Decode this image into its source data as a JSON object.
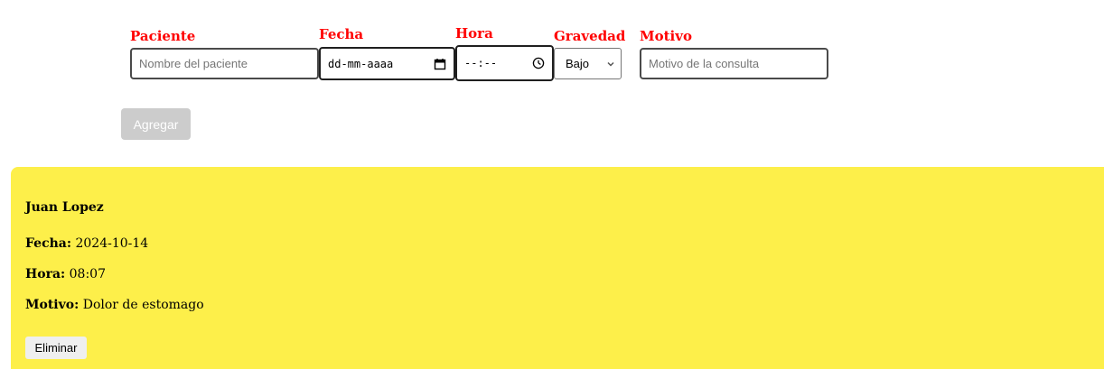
{
  "form": {
    "paciente": {
      "label": "Paciente",
      "placeholder": "Nombre del paciente",
      "value": ""
    },
    "fecha": {
      "label": "Fecha",
      "display": "dd-mm-aaaa",
      "icon": "calendar-icon"
    },
    "hora": {
      "label": "Hora",
      "display": "--:--",
      "icon": "clock-icon"
    },
    "gravedad": {
      "label": "Gravedad",
      "selected": "Bajo",
      "icon": "chevron-down-icon"
    },
    "motivo": {
      "label": "Motivo",
      "placeholder": "Motivo de la consulta",
      "value": ""
    },
    "add_label": "Agregar"
  },
  "appointment": {
    "name": "Juan Lopez",
    "fecha_label": "Fecha:",
    "fecha_value": "2024-10-14",
    "hora_label": "Hora:",
    "hora_value": "08:07",
    "motivo_label": "Motivo:",
    "motivo_value": "Dolor de estomago",
    "delete_label": "Eliminar"
  },
  "colors": {
    "label": "#ff0000",
    "card_background": "#fdef4a",
    "add_button_background": "#cccccc"
  }
}
